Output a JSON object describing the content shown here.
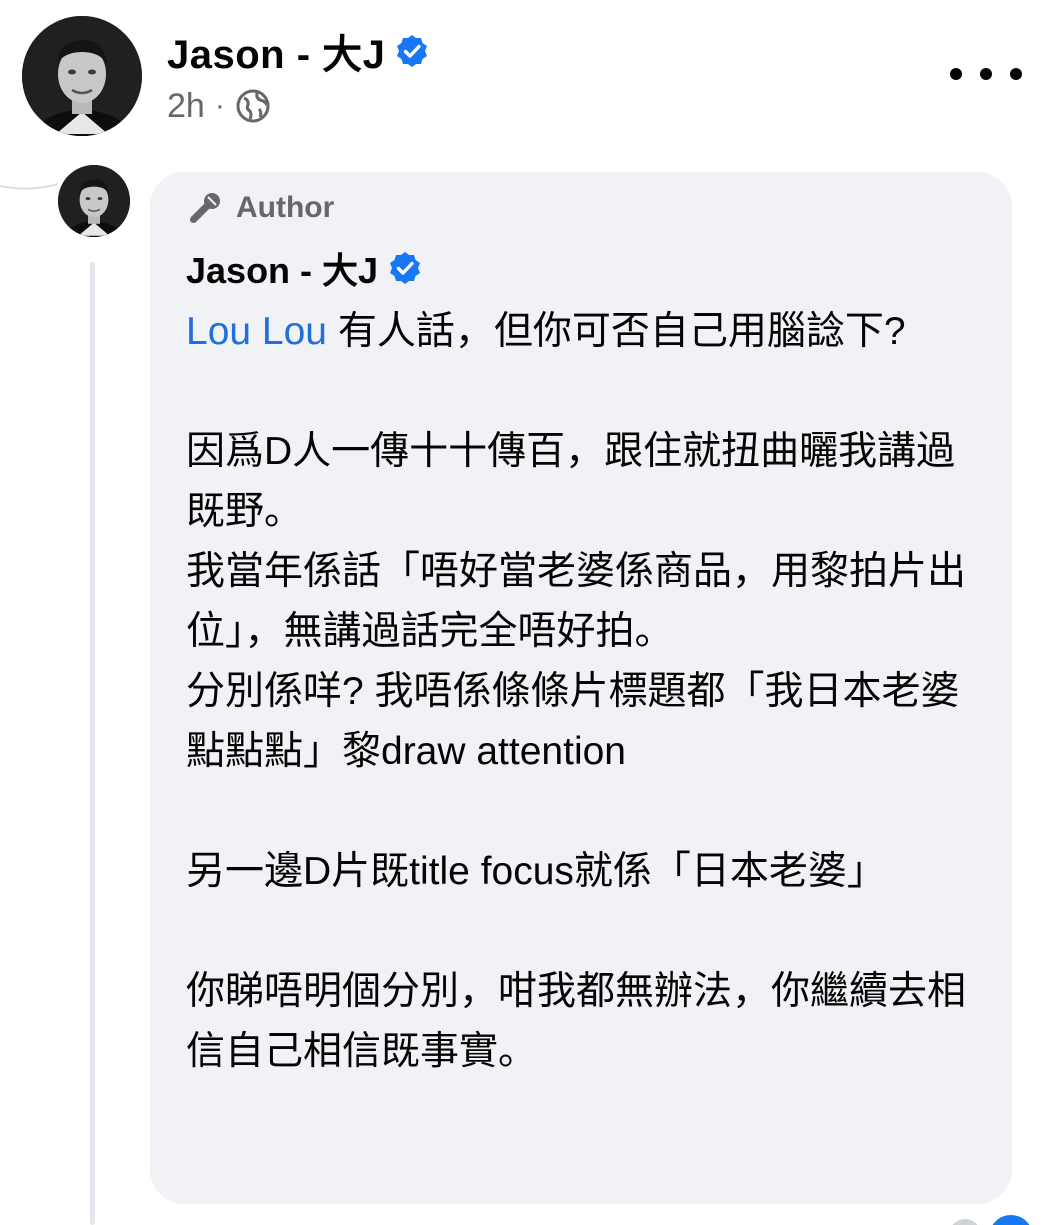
{
  "post": {
    "author_name": "Jason - 大J",
    "time": "2h",
    "dot": "·",
    "privacy_icon": "globe-icon",
    "more_icon": "more-dots-icon"
  },
  "comment": {
    "badge_label": "Author",
    "badge_icon": "microphone-icon",
    "author_name": "Jason - 大J",
    "mention": "Lou Lou",
    "paragraphs": [
      " 有人話，但你可否自己用腦諗下?",
      "因爲D人一傳十十傳百，跟住就扭曲曬我講過既野。",
      "我當年係話「唔好當老婆係商品，用黎拍片出位」，無講過話完全唔好拍。",
      "分別係咩? 我唔係條條片標題都「我日本老婆點點點」黎draw attention",
      "另一邊D片既title focus就係「日本老婆」",
      "你睇唔明個分別，咁我都無辦法，你繼續去相信自己相信既事實。"
    ]
  },
  "colors": {
    "verified_blue": "#1877f2",
    "mention_blue": "#216fdb",
    "bubble_bg": "#f0f2f5",
    "meta_gray": "#65676b"
  }
}
